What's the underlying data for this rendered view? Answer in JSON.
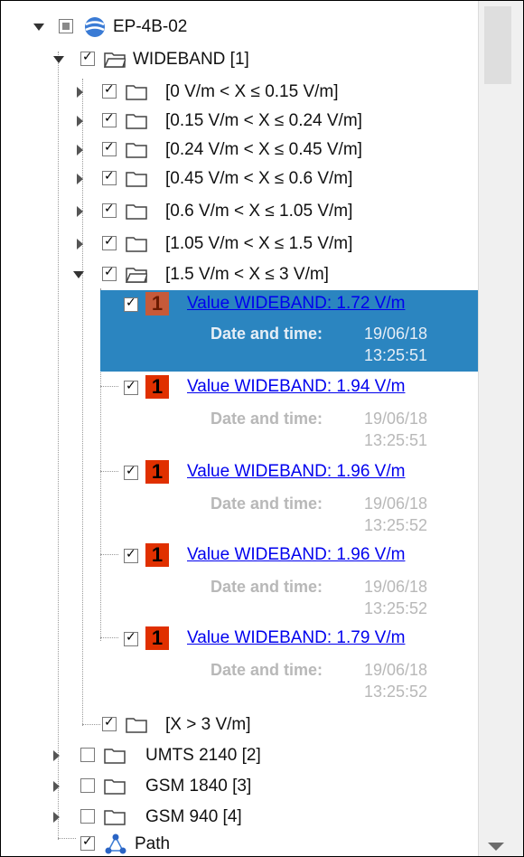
{
  "root": {
    "label": "EP-4B-02"
  },
  "wideband": {
    "label": "WIDEBAND [1]"
  },
  "ranges": [
    "[0 V/m < X ≤ 0.15 V/m]",
    "[0.15 V/m < X ≤ 0.24 V/m]",
    "[0.24 V/m < X ≤ 0.45 V/m]",
    "[0.45 V/m < X ≤ 0.6 V/m]",
    "[0.6 V/m < X ≤ 1.05 V/m]",
    "[1.05 V/m < X ≤ 1.5 V/m]",
    "[1.5 V/m < X ≤ 3 V/m]"
  ],
  "measurements": [
    {
      "badge": "1",
      "link": "Value WIDEBAND: 1.72 V/m",
      "dt_label": "Date and time:",
      "date": "19/06/18",
      "time": "13:25:51"
    },
    {
      "badge": "1",
      "link": "Value WIDEBAND: 1.94 V/m",
      "dt_label": "Date and time:",
      "date": "19/06/18",
      "time": "13:25:51"
    },
    {
      "badge": "1",
      "link": "Value WIDEBAND: 1.96 V/m",
      "dt_label": "Date and time:",
      "date": "19/06/18",
      "time": "13:25:52"
    },
    {
      "badge": "1",
      "link": "Value WIDEBAND: 1.96 V/m",
      "dt_label": "Date and time:",
      "date": "19/06/18",
      "time": "13:25:52"
    },
    {
      "badge": "1",
      "link": "Value WIDEBAND: 1.79 V/m",
      "dt_label": "Date and time:",
      "date": "19/06/18",
      "time": "13:25:52"
    }
  ],
  "range_over": "[X > 3 V/m]",
  "groups": [
    "UMTS 2140 [2]",
    "GSM 1840 [3]",
    "GSM 940 [4]"
  ],
  "path": {
    "label": "Path"
  },
  "colors": {
    "selection": "#2b85c0",
    "badge": "#e03000",
    "link": "#0000ee"
  }
}
